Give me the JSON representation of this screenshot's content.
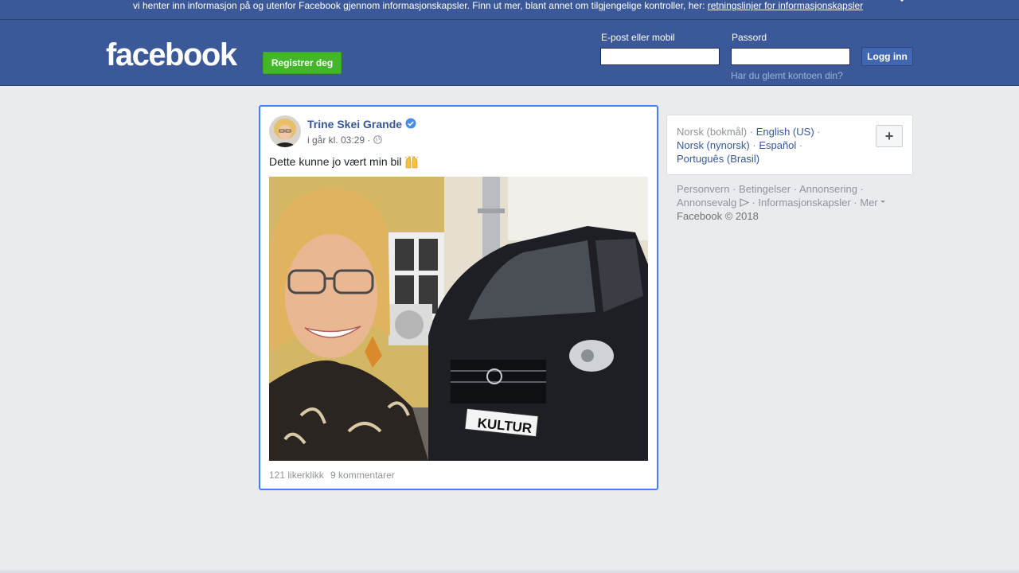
{
  "cookie_banner": {
    "text": "vi henter inn informasjon på og utenfor Facebook gjennom informasjonskapsler. Finn ut mer, blant annet om tilgjengelige kontroller, her: ",
    "link": "retningslinjer for informasjonskapsler"
  },
  "header": {
    "logo": "facebook",
    "register_label": "Registrer deg",
    "email_label": "E-post eller mobil",
    "email_value": "",
    "password_label": "Passord",
    "password_value": "",
    "login_label": "Logg inn",
    "forgot_link": "Har du glemt kontoen din?"
  },
  "post": {
    "author": "Trine Skei Grande",
    "verified": true,
    "timestamp": "i går kl. 03:29 ·",
    "text": "Dette kunne jo vært min bil",
    "likes": "121 likerklikk",
    "comments": "9 kommentarer",
    "plate_text": "KULTUR"
  },
  "languages": {
    "current": "Norsk (bokmål)",
    "items": [
      "English (US)",
      "Norsk (nynorsk)",
      "Español",
      "Português (Brasil)"
    ],
    "add_label": "+"
  },
  "footer": {
    "links": [
      "Personvern",
      "Betingelser",
      "Annonsering",
      "Annonsevalg",
      "Informasjonskapsler",
      "Mer"
    ],
    "copyright": "Facebook © 2018"
  },
  "colors": {
    "brand_blue": "#3b5998",
    "register_green": "#42b72a",
    "link_blue": "#365899",
    "focus_border": "#4080ff"
  }
}
